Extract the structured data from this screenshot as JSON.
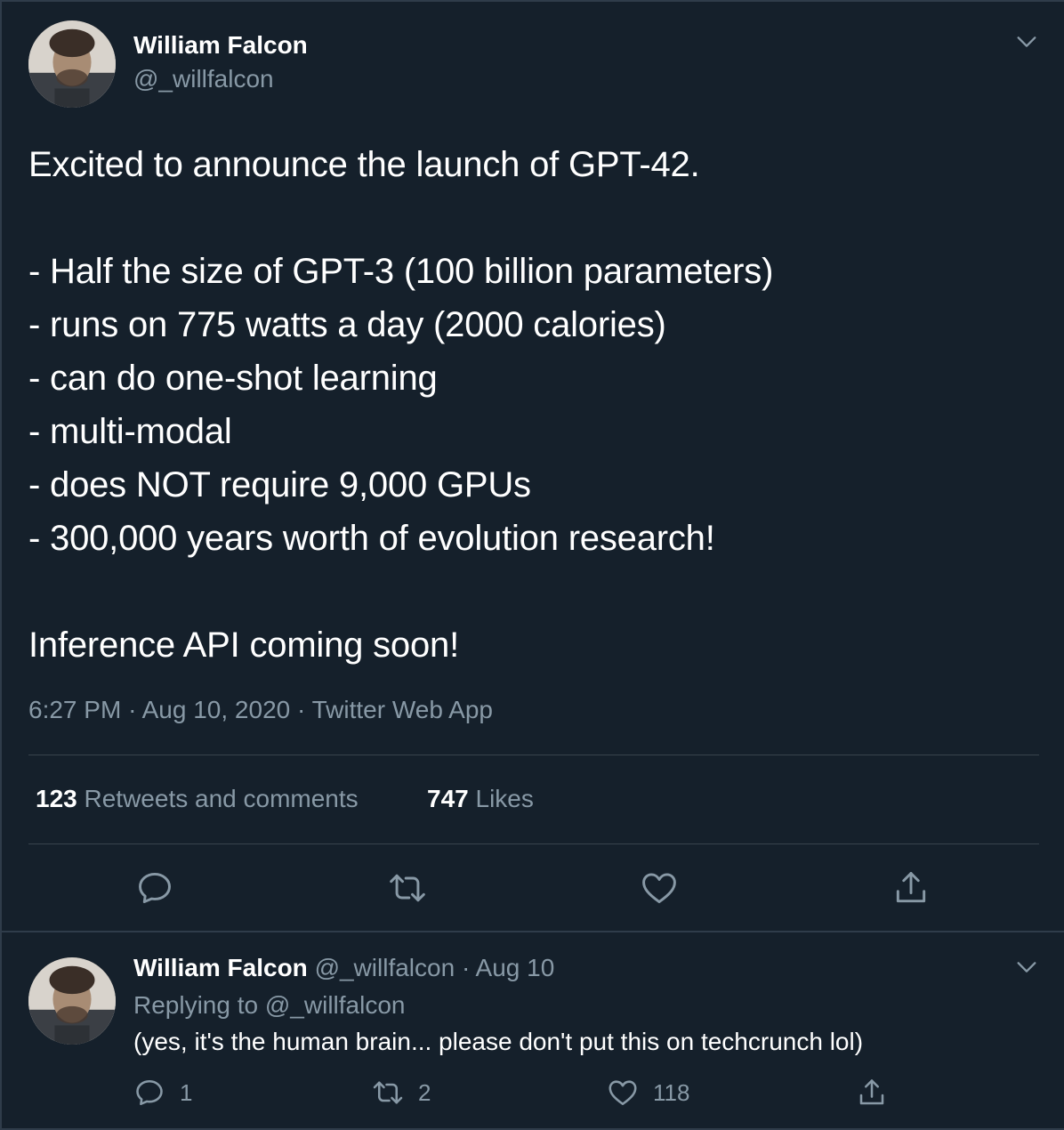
{
  "colors": {
    "background": "#15202b",
    "text_primary": "#ffffff",
    "text_secondary": "#8899a6",
    "divider": "#38444d"
  },
  "main_tweet": {
    "author": {
      "name": "William Falcon",
      "handle": "@_willfalcon",
      "avatar_icon": "profile-photo"
    },
    "menu_icon": "chevron-down-icon",
    "lines": [
      "Excited to announce the launch of GPT-42.",
      "",
      "- Half the size of GPT-3 (100 billion parameters)",
      "- runs on 775 watts a day (2000 calories)",
      "- can do one-shot learning",
      "- multi-modal",
      "- does NOT require 9,000 GPUs",
      "- 300,000 years worth of evolution research!",
      "",
      "Inference API coming soon!"
    ],
    "time": "6:27 PM",
    "date": "Aug 10, 2020",
    "source": "Twitter Web App",
    "stats": {
      "retweets_count": "123",
      "retweets_label": "Retweets and comments",
      "likes_count": "747",
      "likes_label": "Likes"
    },
    "actions": [
      {
        "icon": "reply-icon"
      },
      {
        "icon": "retweet-icon"
      },
      {
        "icon": "like-icon"
      },
      {
        "icon": "share-icon"
      }
    ]
  },
  "reply_tweet": {
    "author": {
      "name": "William Falcon",
      "handle": "@_willfalcon",
      "avatar_icon": "profile-photo"
    },
    "date": "Aug 10",
    "replying_prefix": "Replying to",
    "replying_to": "@_willfalcon",
    "text": "(yes, it's the human brain... please don't put this on techcrunch lol)",
    "menu_icon": "chevron-down-icon",
    "actions": {
      "replies": "1",
      "retweets": "2",
      "likes": "118"
    }
  }
}
